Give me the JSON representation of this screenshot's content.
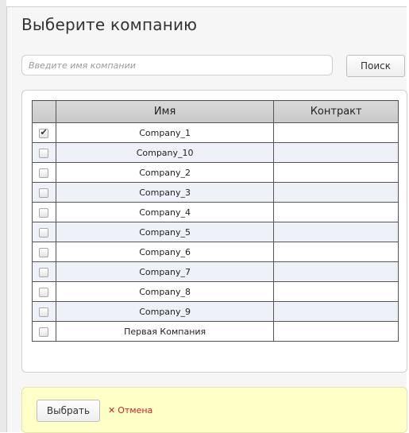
{
  "dialog": {
    "title": "Выберите компанию"
  },
  "search": {
    "placeholder": "Введите имя компании",
    "value": "",
    "button_label": "Поиск"
  },
  "table": {
    "headers": [
      "",
      "Имя",
      "Контракт"
    ],
    "rows": [
      {
        "name": "Company_1",
        "contract": "",
        "checked": true
      },
      {
        "name": "Company_10",
        "contract": "",
        "checked": false
      },
      {
        "name": "Company_2",
        "contract": "",
        "checked": false
      },
      {
        "name": "Company_3",
        "contract": "",
        "checked": false
      },
      {
        "name": "Company_4",
        "contract": "",
        "checked": false
      },
      {
        "name": "Company_5",
        "contract": "",
        "checked": false
      },
      {
        "name": "Company_6",
        "contract": "",
        "checked": false
      },
      {
        "name": "Company_7",
        "contract": "",
        "checked": false
      },
      {
        "name": "Company_8",
        "contract": "",
        "checked": false
      },
      {
        "name": "Company_9",
        "contract": "",
        "checked": false
      },
      {
        "name": "Первая Компания",
        "contract": "",
        "checked": false
      }
    ]
  },
  "footer": {
    "choose_label": "Выбрать",
    "cancel_icon": "✕",
    "cancel_label": "Отмена"
  },
  "colors": {
    "footer_bg": "#ffffc8",
    "cancel_text": "#cc2222",
    "alt_row": "#eef2f8"
  }
}
